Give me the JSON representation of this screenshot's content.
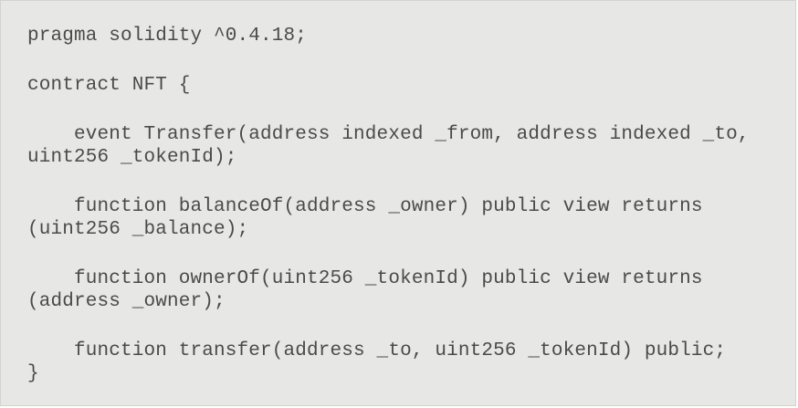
{
  "code": {
    "lines": [
      "pragma solidity ^0.4.18;",
      "contract NFT {",
      "    event Transfer(address indexed _from, address indexed _to,",
      "uint256 _tokenId);",
      "    function balanceOf(address _owner) public view returns",
      "(uint256 _balance);",
      "    function ownerOf(uint256 _tokenId) public view returns",
      "(address _owner);",
      "    function transfer(address _to, uint256 _tokenId) public;",
      "}"
    ]
  }
}
